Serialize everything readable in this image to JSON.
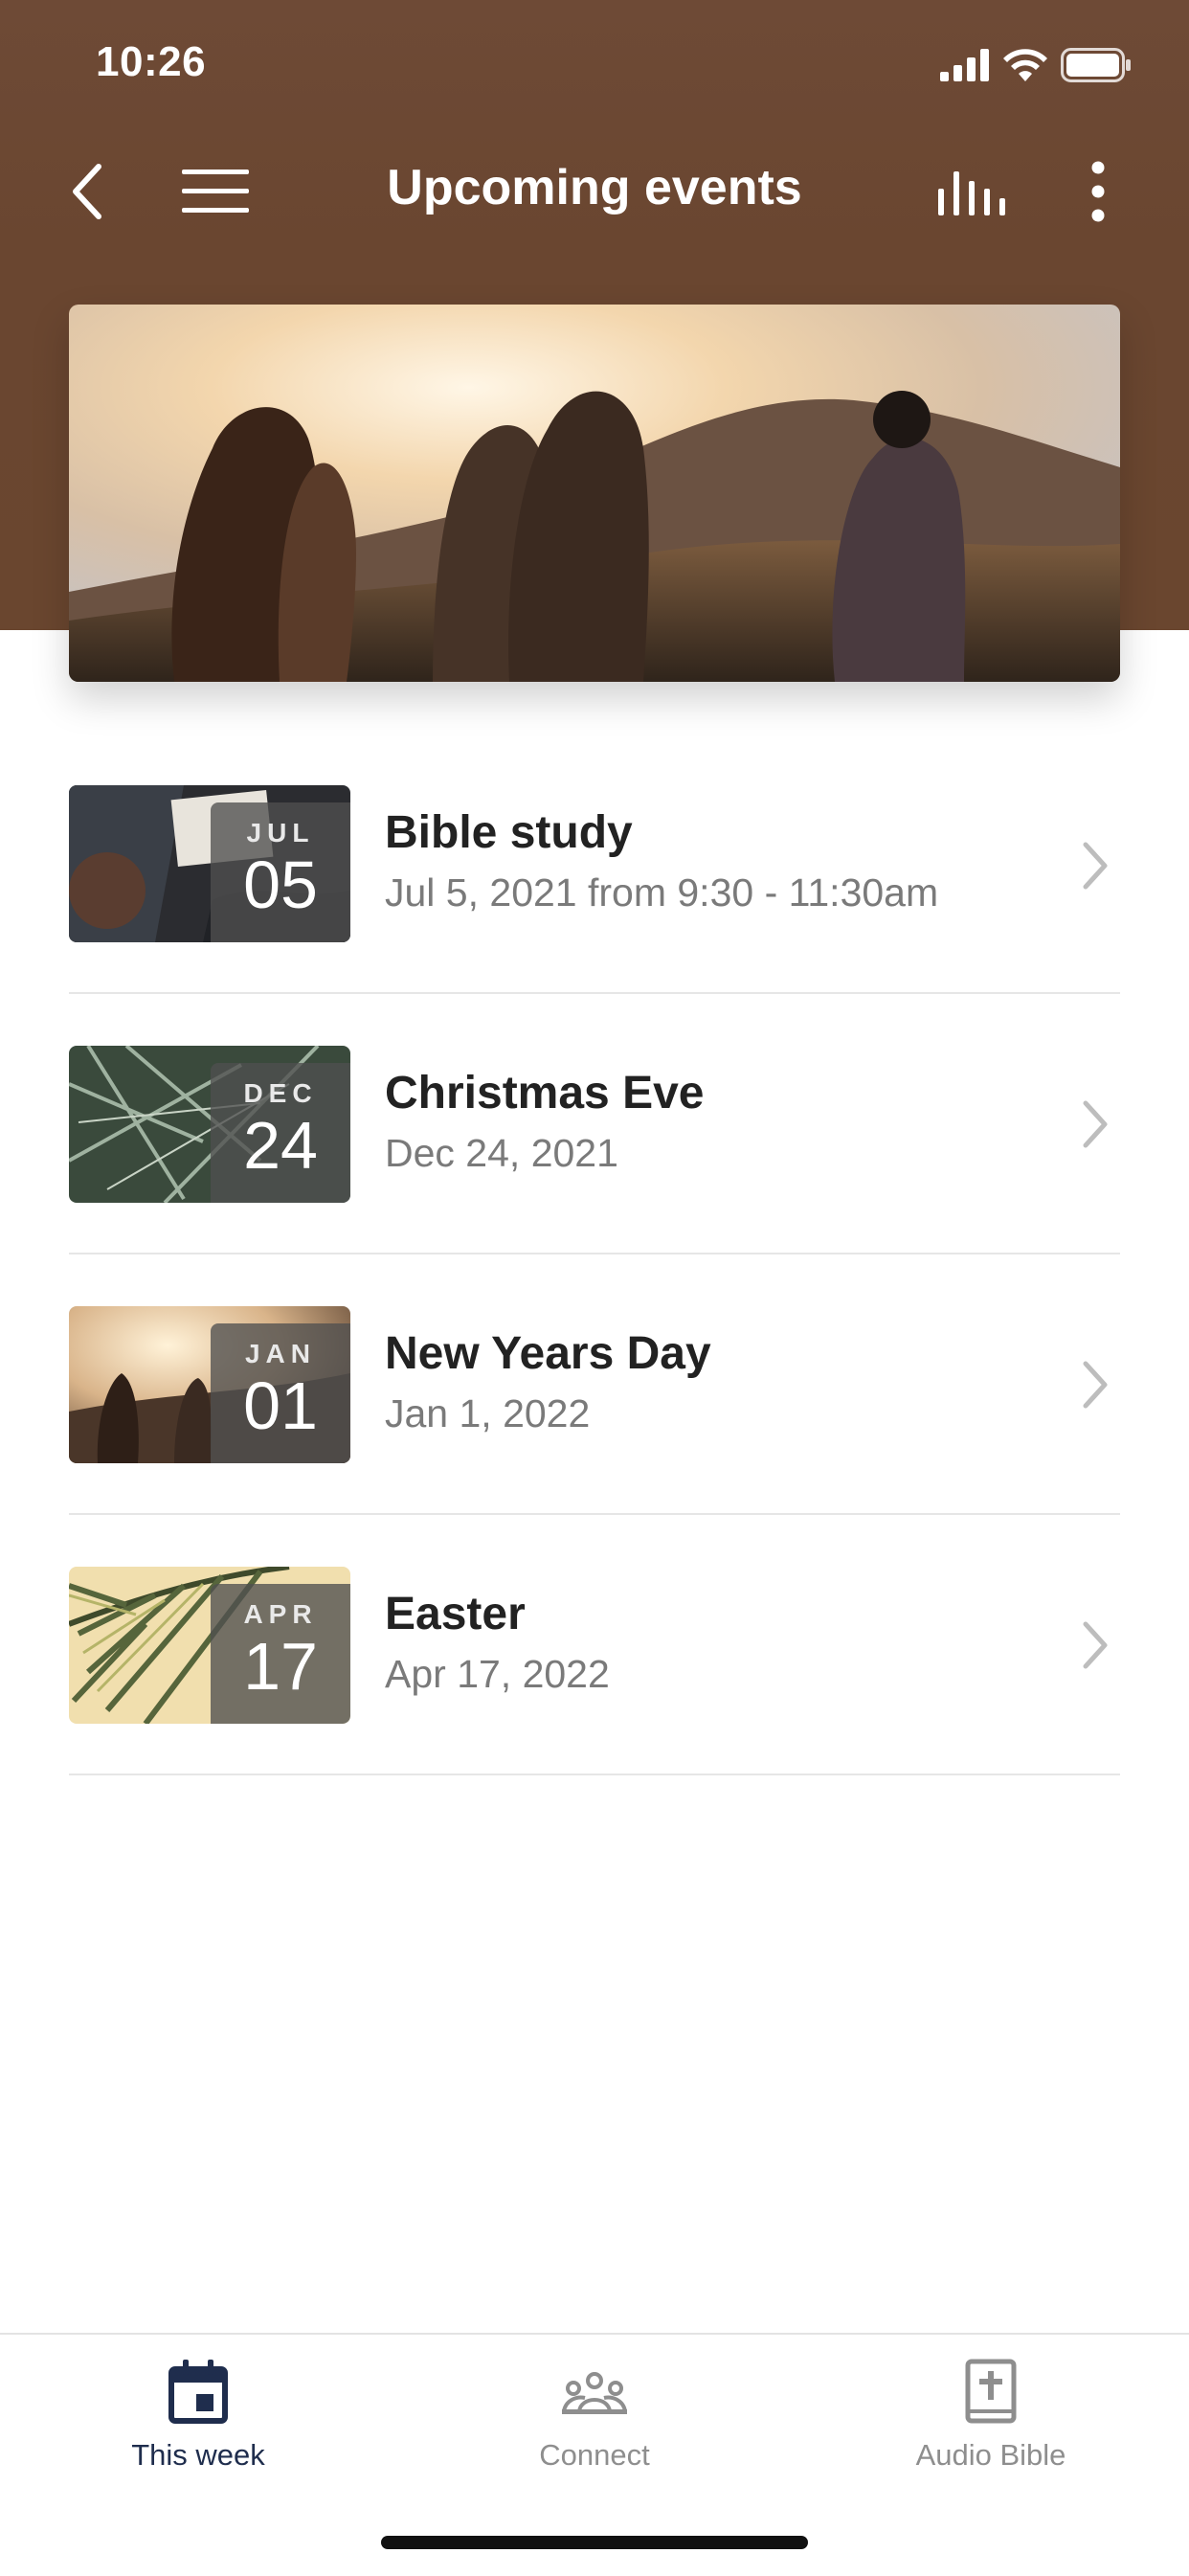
{
  "status": {
    "time": "10:26"
  },
  "appbar": {
    "title": "Upcoming events"
  },
  "icons": {
    "back": "chevron-left-icon",
    "menu": "hamburger-menu-icon",
    "stats": "bar-chart-icon",
    "more": "more-vertical-icon"
  },
  "events": [
    {
      "month": "JUL",
      "day": "05",
      "name": "Bible study",
      "when": "Jul 5, 2021 from 9:30 - 11:30am"
    },
    {
      "month": "DEC",
      "day": "24",
      "name": "Christmas Eve",
      "when": "Dec 24, 2021"
    },
    {
      "month": "JAN",
      "day": "01",
      "name": "New Years Day",
      "when": "Jan 1, 2022"
    },
    {
      "month": "APR",
      "day": "17",
      "name": "Easter",
      "when": "Apr 17, 2022"
    }
  ],
  "tabs": [
    {
      "label": "This week",
      "active": true
    },
    {
      "label": "Connect",
      "active": false
    },
    {
      "label": "Audio Bible",
      "active": false
    }
  ],
  "colors": {
    "header": "#6a462f",
    "active_tab": "#1f2d4d",
    "inactive_tab": "#8e8e8e"
  }
}
